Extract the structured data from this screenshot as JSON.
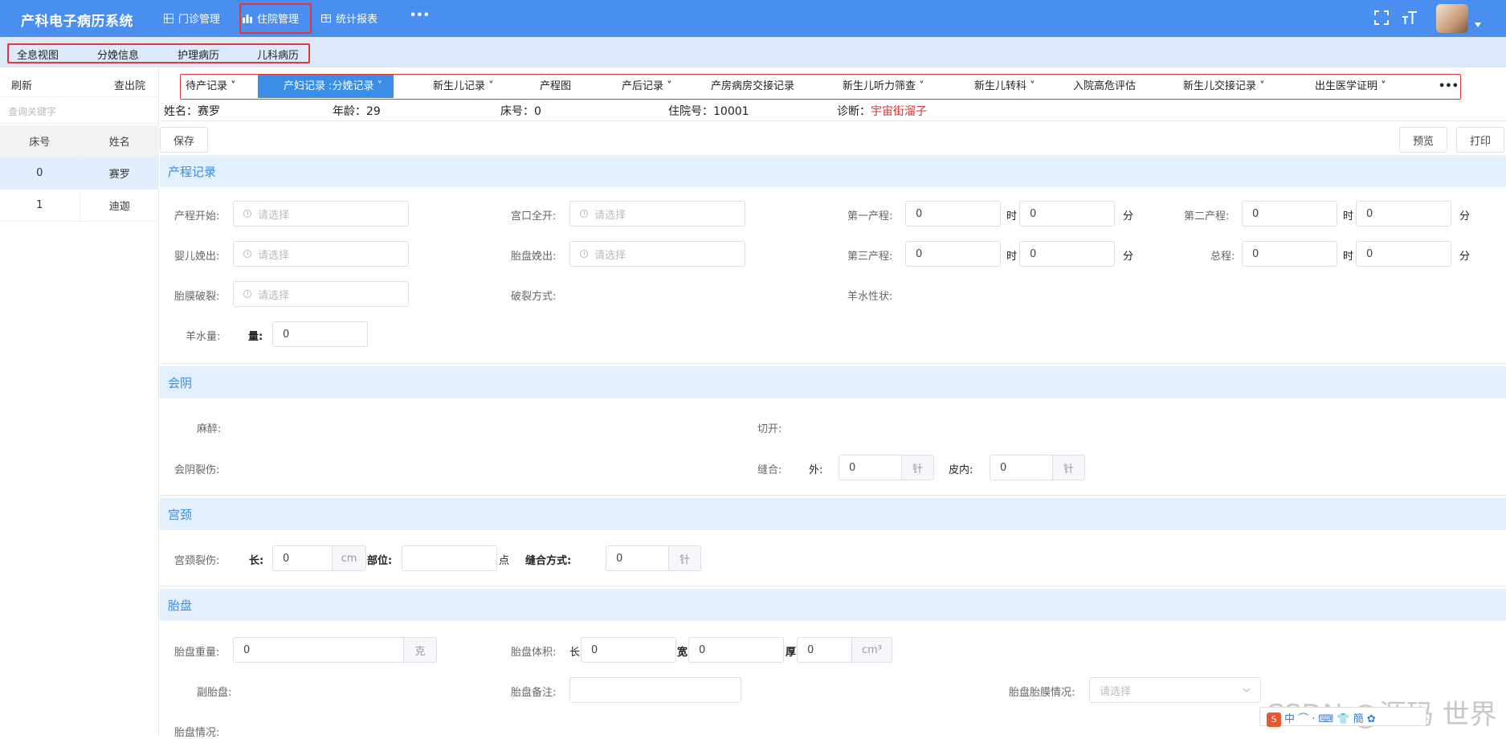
{
  "app": {
    "title": "产科电子病历系统"
  },
  "topnav": [
    {
      "label": "门诊管理",
      "icon": "grid-icon"
    },
    {
      "label": "住院管理",
      "icon": "bar-chart-icon"
    },
    {
      "label": "统计报表",
      "icon": "table-icon"
    },
    {
      "label": "•••",
      "icon": "more-icon"
    }
  ],
  "subnav": [
    "全息视图",
    "分娩信息",
    "护理病历",
    "儿科病历"
  ],
  "left": {
    "refresh": "刷新",
    "discharge": "查出院",
    "search_placeholder": "查询关键字",
    "columns": [
      "床号",
      "姓名"
    ],
    "rows": [
      [
        "0",
        "赛罗"
      ],
      [
        "1",
        "迪迦"
      ]
    ]
  },
  "tabs": [
    {
      "label": "待产记录",
      "caret": true
    },
    {
      "label": "产妇记录 :分娩记录",
      "caret": true
    },
    {
      "label": "新生儿记录",
      "caret": true
    },
    {
      "label": "产程图",
      "caret": false
    },
    {
      "label": "产后记录",
      "caret": true
    },
    {
      "label": "产房病房交接记录",
      "caret": false
    },
    {
      "label": "新生儿听力筛查",
      "caret": true
    },
    {
      "label": "新生儿转科",
      "caret": true
    },
    {
      "label": "入院高危评估",
      "caret": false
    },
    {
      "label": "新生儿交接记录",
      "caret": true
    },
    {
      "label": "出生医学证明",
      "caret": true
    },
    {
      "label": "•••",
      "caret": false
    }
  ],
  "patient": {
    "name_label": "姓名：",
    "name": "赛罗",
    "age_label": "年龄：",
    "age": "29",
    "bed_label": "床号：",
    "bed": "0",
    "admission_label": "住院号：",
    "admission": "10001",
    "diagnosis_label": "诊断：",
    "diagnosis": "宇宙街溜子"
  },
  "toolbar": {
    "save": "保存",
    "preview": "预览",
    "print": "打印"
  },
  "labor": {
    "title": "产程记录",
    "start_label": "产程开始:",
    "start_ph": "请选择",
    "dilation_label": "宫口全开:",
    "dilation_ph": "请选择",
    "stage1_label": "第一产程:",
    "stage1_h": "0",
    "stage1_m": "0",
    "stage2_label": "第二产程:",
    "stage2_h": "0",
    "stage2_m": "0",
    "baby_label": "婴儿娩出:",
    "baby_ph": "请选择",
    "placenta_label": "胎盘娩出:",
    "placenta_ph": "请选择",
    "stage3_label": "第三产程:",
    "stage3_h": "0",
    "stage3_m": "0",
    "total_label": "总程:",
    "total_h": "0",
    "total_m": "0",
    "rupture_label": "胎膜破裂:",
    "rupture_ph": "请选择",
    "rupture_method_label": "破裂方式:",
    "amniotic_nature_label": "羊水性状:",
    "amniotic_amount_label": "羊水量:",
    "amount_label": "量:",
    "amount": "0",
    "hour": "时",
    "minute": "分"
  },
  "perineum": {
    "title": "会阴",
    "anesthesia_label": "麻醉:",
    "incision_label": "切开:",
    "laceration_label": "会阴裂伤:",
    "suture_label": "缝合:",
    "outer_label": "外:",
    "outer": "0",
    "intra_label": "皮内:",
    "intra": "0",
    "needle": "针"
  },
  "cervix": {
    "title": "宫颈",
    "laceration_label": "宫颈裂伤:",
    "length_label": "长:",
    "length": "0",
    "length_unit": "cm",
    "position_label": "部位:",
    "position": "",
    "point": "点",
    "suture_method_label": "缝合方式:",
    "suture": "0",
    "needle": "针"
  },
  "placenta": {
    "title": "胎盘",
    "weight_label": "胎盘重量:",
    "weight": "0",
    "weight_unit": "克",
    "volume_label": "胎盘体积:",
    "len_label": "长",
    "len": "0",
    "width_label": "宽",
    "width": "0",
    "thick_label": "厚",
    "thick": "0",
    "volume_unit": "cm³",
    "accessory_label": "副胎盘:",
    "note_label": "胎盘备注:",
    "note": "",
    "membrane_label": "胎盘胎膜情况:",
    "membrane_ph": "请选择",
    "status_label": "胎盘情况:"
  },
  "watermark": "CSDN @源码 世界",
  "ime": {
    "logo": "S",
    "text": "中 ⌒ · ⌨ 👕 簡 ✿"
  }
}
